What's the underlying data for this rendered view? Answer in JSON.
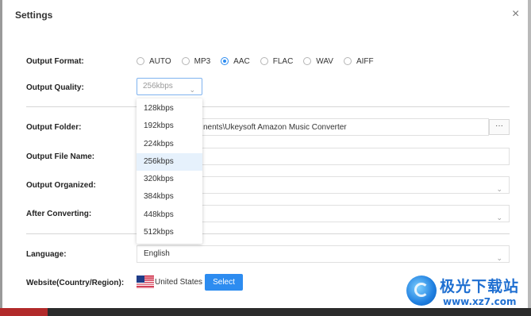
{
  "window": {
    "title": "Settings",
    "close_glyph": "×"
  },
  "labels": {
    "output_format": "Output Format:",
    "output_quality": "Output Quality:",
    "output_folder": "Output Folder:",
    "output_file_name": "Output File Name:",
    "output_organized": "Output Organized:",
    "after_converting": "After Converting:",
    "language": "Language:",
    "website": "Website(Country/Region):"
  },
  "output_format": {
    "options": [
      "AUTO",
      "MP3",
      "AAC",
      "FLAC",
      "WAV",
      "AIFF"
    ],
    "selected": "AAC"
  },
  "output_quality": {
    "value": "256kbps",
    "options": [
      "128kbps",
      "192kbps",
      "224kbps",
      "256kbps",
      "320kbps",
      "384kbps",
      "448kbps",
      "512kbps"
    ],
    "selected": "256kbps"
  },
  "output_folder": {
    "visible_text": "nents\\Ukeysoft Amazon Music Converter",
    "browse_label": "···"
  },
  "language": {
    "value": "English"
  },
  "website": {
    "country": "United States",
    "select_label": "Select"
  },
  "icons": {
    "chevron": "chevron-down-icon",
    "close": "close-icon",
    "flag": "us-flag-icon"
  },
  "colors": {
    "accent": "#2d8cf0",
    "selected_row": "#e6f1fc",
    "divider": "#d6d6d6"
  },
  "watermark": {
    "cn": "极光下载站",
    "url": "www.xz7.com"
  }
}
